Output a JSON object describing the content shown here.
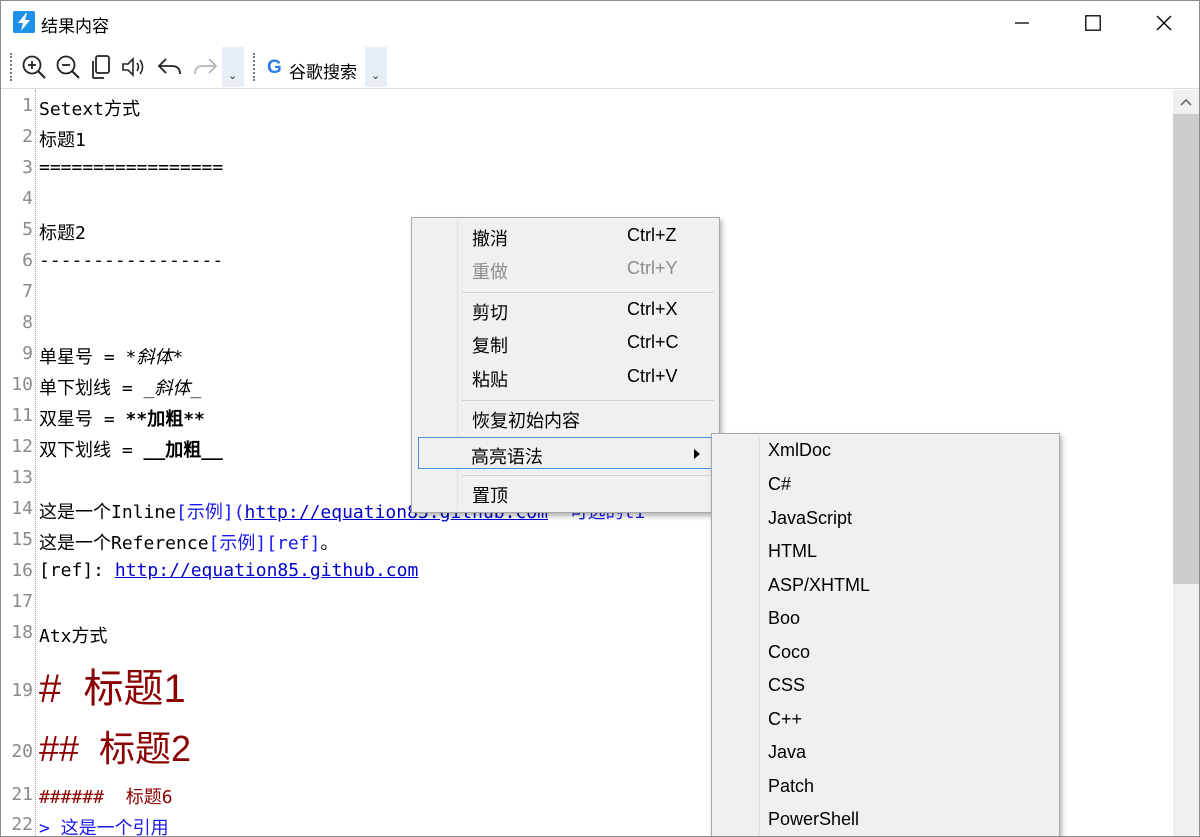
{
  "window": {
    "title": "结果内容",
    "accent": "#1e90e8"
  },
  "toolbar": {
    "icons": [
      "zoom-in-icon",
      "zoom-out-icon",
      "copy-icon",
      "speaker-icon",
      "undo-icon",
      "redo-icon"
    ],
    "search_letter": "G",
    "search_label": "谷歌搜索",
    "dropdown_glyph": "⌄"
  },
  "editor": {
    "line_numbers": [
      "1",
      "2",
      "3",
      "4",
      "5",
      "6",
      "7",
      "8",
      "9",
      "10",
      "11",
      "12",
      "13",
      "14",
      "15",
      "16",
      "17",
      "18",
      "19",
      "20",
      "21",
      "22"
    ],
    "lines": {
      "l1": "Setext方式",
      "l2": "标题1",
      "l3": "=================",
      "l5": "标题2",
      "l6": "-----------------",
      "l9_a": "单星号 = ",
      "l9_b": "*斜体*",
      "l10_a": "单下划线 = ",
      "l10_b": "_斜体_",
      "l11_a": "双星号 = ",
      "l11_b": "**加粗**",
      "l12_a": "双下划线 = ",
      "l12_b": "__加粗__",
      "l14_a": "这是一个Inline",
      "l14_b": "[示例](",
      "l14_c": "http://equation85.github.com",
      "l14_d": " \"可选的ti",
      "l15_a": "这是一个Reference",
      "l15_b": "[示例][ref]",
      "l15_c": "。",
      "l16_a": "[ref]: ",
      "l16_b": "http://equation85.github.com",
      "l18": "Atx方式",
      "l19": "#  标题1",
      "l20": "##  标题2",
      "l21": "######  标题6",
      "l22": "> 这是一个引用"
    }
  },
  "context_menu": {
    "undo": {
      "label": "撤消",
      "shortcut": "Ctrl+Z"
    },
    "redo": {
      "label": "重做",
      "shortcut": "Ctrl+Y"
    },
    "cut": {
      "label": "剪切",
      "shortcut": "Ctrl+X"
    },
    "copy": {
      "label": "复制",
      "shortcut": "Ctrl+C"
    },
    "paste": {
      "label": "粘贴",
      "shortcut": "Ctrl+V"
    },
    "restore": {
      "label": "恢复初始内容"
    },
    "highlight": {
      "label": "高亮语法"
    },
    "topmost": {
      "label": "置顶"
    }
  },
  "submenu": {
    "items": [
      "XmlDoc",
      "C#",
      "JavaScript",
      "HTML",
      "ASP/XHTML",
      "Boo",
      "Coco",
      "CSS",
      "C++",
      "Java",
      "Patch",
      "PowerShell"
    ]
  }
}
